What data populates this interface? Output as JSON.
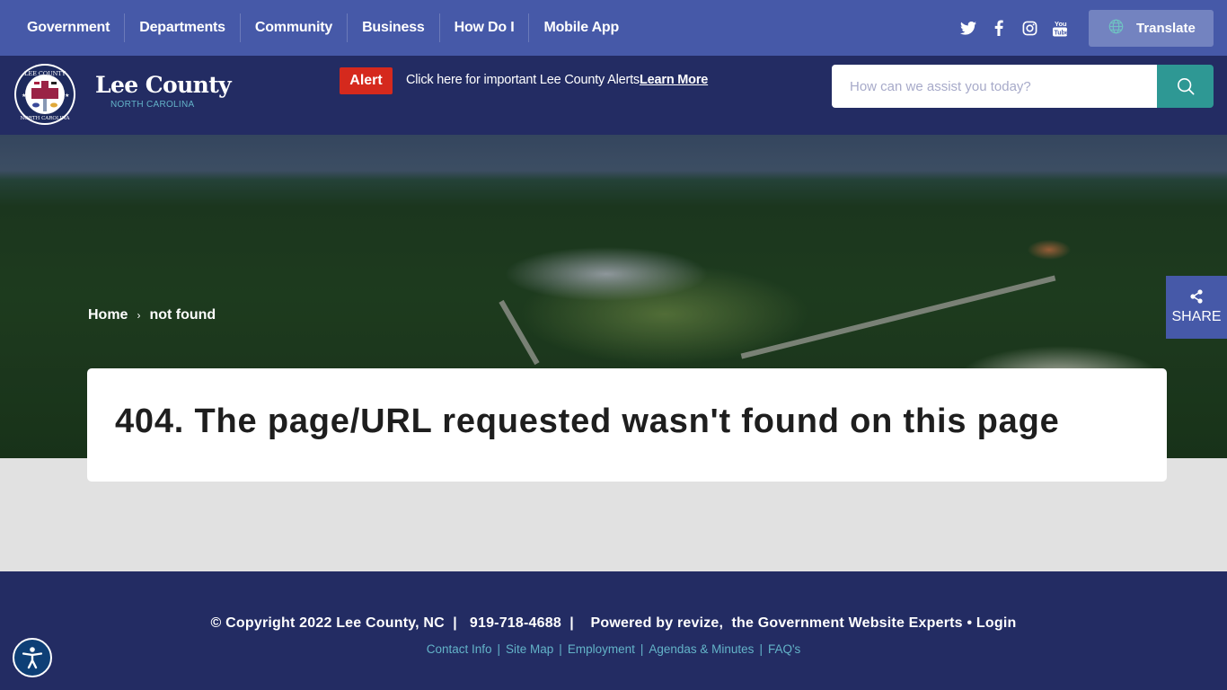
{
  "topnav": {
    "items": [
      "Government",
      "Departments",
      "Community",
      "Business",
      "How Do I",
      "Mobile App"
    ],
    "social": [
      "twitter-icon",
      "facebook-icon",
      "instagram-icon",
      "youtube-icon"
    ],
    "translate_label": "Translate"
  },
  "header": {
    "brand_name": "Lee County",
    "brand_sub": "NORTH CAROLINA",
    "alert_badge": "Alert",
    "alert_text": "Click here for important Lee County Alerts",
    "alert_link": "Learn More",
    "search_placeholder": "How can we assist you today?",
    "search_value": ""
  },
  "breadcrumb": {
    "home": "Home",
    "separator": "›",
    "current": "not found"
  },
  "share_label": "SHARE",
  "content": {
    "heading": "404. The page/URL requested wasn't found on this page"
  },
  "footer": {
    "copyright": "© Copyright 2022 Lee County, NC",
    "divider": "|",
    "phone": "919-718-4688",
    "powered": "Powered by revize,  the Government Website Experts",
    "bullet": "•",
    "login": "Login",
    "links": [
      "Contact Info",
      "Site Map",
      "Employment",
      "Agendas & Minutes",
      "FAQ's"
    ]
  },
  "colors": {
    "topbar": "#4659a8",
    "header": "#232c63",
    "alert": "#d5291d",
    "search_button": "#2e9894",
    "accent_teal": "#63b3c8",
    "page_bg": "#e1e1e1"
  }
}
